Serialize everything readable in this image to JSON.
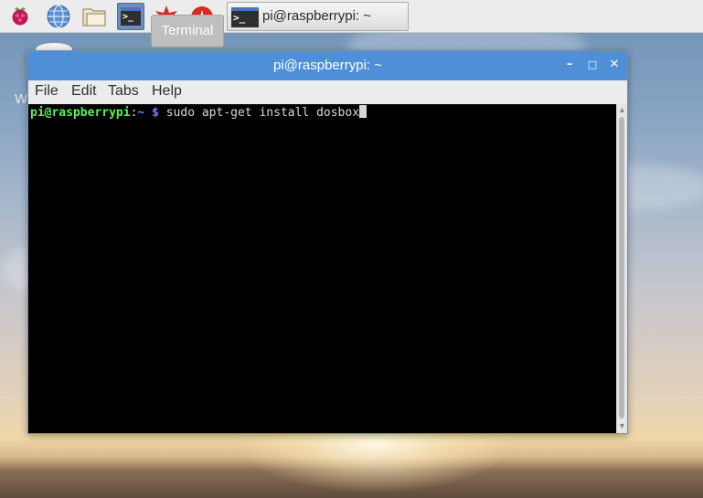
{
  "taskbar": {
    "launchers": [
      {
        "name": "menu",
        "icon": "raspberry-icon"
      },
      {
        "name": "web-browser",
        "icon": "globe-icon"
      },
      {
        "name": "file-manager",
        "icon": "folder-icon"
      },
      {
        "name": "terminal",
        "icon": "terminal-icon"
      },
      {
        "name": "mathematica",
        "icon": "mathematica-icon"
      },
      {
        "name": "wolfram",
        "icon": "wolfram-icon"
      }
    ],
    "terminal_glyph": ">_",
    "task_button_label": "pi@raspberrypi: ~",
    "tooltip": "Terminal"
  },
  "desktop": {
    "partial_letter": "W"
  },
  "window": {
    "title": "pi@raspberrypi: ~",
    "controls": {
      "minimize": "–",
      "maximize": "□",
      "close": "✕"
    },
    "menu": [
      "File",
      "Edit",
      "Tabs",
      "Help"
    ]
  },
  "terminal": {
    "user_host": "pi@raspberrypi",
    "colon": ":",
    "path_prompt": "~ $",
    "command": " sudo apt-get install dosbox"
  },
  "colors": {
    "titlebar": "#4f8fd8",
    "prompt_user": "#5ef05e",
    "prompt_path": "#7b7bff",
    "terminal_bg": "#000000"
  }
}
